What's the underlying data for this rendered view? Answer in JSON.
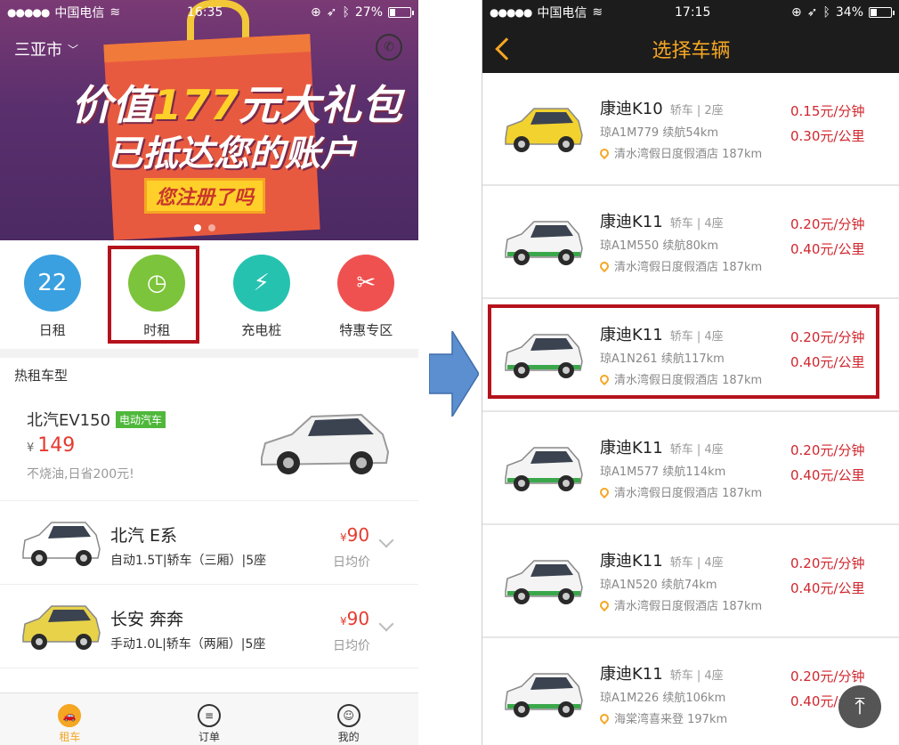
{
  "left_screen": {
    "status": {
      "carrier": "中国电信",
      "time": "16:35",
      "battery": "27%",
      "battery_level": 0.27
    },
    "city": "三亚市",
    "banner": {
      "line1_a": "价值",
      "line1_num": "177",
      "line1_b": "元大礼包",
      "line2": "已抵达您的账户",
      "button": "您注册了吗"
    },
    "quick_actions": [
      {
        "label": "日租",
        "icon": "calendar-icon",
        "color": "#3aa0e0",
        "glyph": "22"
      },
      {
        "label": "时租",
        "icon": "clock-pin-icon",
        "color": "#7cc43b",
        "glyph": "◷"
      },
      {
        "label": "充电桩",
        "icon": "charging-plug-icon",
        "color": "#26c2b0",
        "glyph": "⚡"
      },
      {
        "label": "特惠专区",
        "icon": "ticket-icon",
        "color": "#ef5150",
        "glyph": "✂"
      }
    ],
    "hot_title": "热租车型",
    "hot_car": {
      "name": "北汽EV150",
      "badge": "电动汽车",
      "currency": "¥",
      "price": "149",
      "note": "不烧油,日省200元!"
    },
    "cars": [
      {
        "name": "北汽 E系",
        "spec": "自动1.5T|轿车（三厢）|5座",
        "currency": "¥",
        "price": "90",
        "price_label": "日均价",
        "color": "#ffffff"
      },
      {
        "name": "长安 奔奔",
        "spec": "手动1.0L|轿车（两厢）|5座",
        "currency": "¥",
        "price": "90",
        "price_label": "日均价",
        "color": "#e8d24a"
      }
    ],
    "tabs": [
      {
        "label": "租车",
        "icon": "car-icon"
      },
      {
        "label": "订单",
        "icon": "list-icon"
      },
      {
        "label": "我的",
        "icon": "user-icon"
      }
    ]
  },
  "right_screen": {
    "status": {
      "carrier": "中国电信",
      "time": "17:15",
      "battery": "34%",
      "battery_level": 0.34
    },
    "title": "选择车辆",
    "vehicles": [
      {
        "name": "康迪K10",
        "type": "轿车 | 2座",
        "plate": "琼A1M779 续航54km",
        "location": "清水湾假日度假酒店 187km",
        "price_min": "0.15元/分钟",
        "price_km": "0.30元/公里",
        "color": "#f2d22e"
      },
      {
        "name": "康迪K11",
        "type": "轿车 | 4座",
        "plate": "琼A1M550 续航80km",
        "location": "清水湾假日度假酒店 187km",
        "price_min": "0.20元/分钟",
        "price_km": "0.40元/公里",
        "color": "#f4f4f4"
      },
      {
        "name": "康迪K11",
        "type": "轿车 | 4座",
        "plate": "琼A1N261 续航117km",
        "location": "清水湾假日度假酒店 187km",
        "price_min": "0.20元/分钟",
        "price_km": "0.40元/公里",
        "color": "#f4f4f4"
      },
      {
        "name": "康迪K11",
        "type": "轿车 | 4座",
        "plate": "琼A1M577 续航114km",
        "location": "清水湾假日度假酒店 187km",
        "price_min": "0.20元/分钟",
        "price_km": "0.40元/公里",
        "color": "#f4f4f4"
      },
      {
        "name": "康迪K11",
        "type": "轿车 | 4座",
        "plate": "琼A1N520 续航74km",
        "location": "清水湾假日度假酒店 187km",
        "price_min": "0.20元/分钟",
        "price_km": "0.40元/公里",
        "color": "#f4f4f4"
      },
      {
        "name": "康迪K11",
        "type": "轿车 | 4座",
        "plate": "琼A1M226 续航106km",
        "location": "海棠湾喜来登 197km",
        "price_min": "0.20元/分钟",
        "price_km": "0.40元/公里",
        "color": "#f4f4f4"
      }
    ],
    "back_to_top": "⤒"
  },
  "colors": {
    "accent": "#f5a623",
    "price_red": "#d0262d",
    "highlight": "#b5121b",
    "arrow": "#5b8fd0"
  }
}
